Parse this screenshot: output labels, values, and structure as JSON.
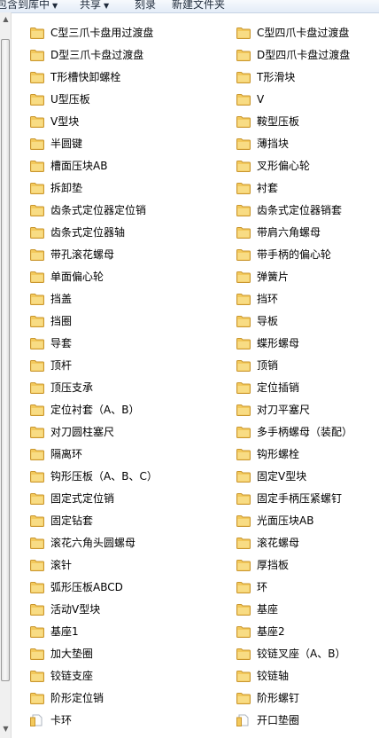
{
  "toolbar": {
    "items": [
      {
        "label": "包含到库中",
        "dropdown": true
      },
      {
        "label": "共享",
        "dropdown": true
      },
      {
        "label": "刻录",
        "dropdown": false
      },
      {
        "label": "新建文件夹",
        "dropdown": false
      }
    ]
  },
  "folder_color": "#f3c95c",
  "files": {
    "left": [
      {
        "name": "C型三爪卡盘用过渡盘",
        "icon": "folder-icon"
      },
      {
        "name": "D型三爪卡盘过渡盘",
        "icon": "folder-icon"
      },
      {
        "name": "T形槽快卸螺栓",
        "icon": "folder-icon"
      },
      {
        "name": "U型压板",
        "icon": "folder-icon"
      },
      {
        "name": "V型块",
        "icon": "folder-icon"
      },
      {
        "name": "半圆键",
        "icon": "folder-icon"
      },
      {
        "name": "槽面压块AB",
        "icon": "folder-icon"
      },
      {
        "name": "拆卸垫",
        "icon": "folder-icon"
      },
      {
        "name": "齿条式定位器定位销",
        "icon": "folder-icon"
      },
      {
        "name": "齿条式定位器轴",
        "icon": "folder-icon"
      },
      {
        "name": "带孔滚花螺母",
        "icon": "folder-icon"
      },
      {
        "name": "单面偏心轮",
        "icon": "folder-icon"
      },
      {
        "name": "挡盖",
        "icon": "folder-icon"
      },
      {
        "name": "挡圈",
        "icon": "folder-icon"
      },
      {
        "name": "导套",
        "icon": "folder-icon"
      },
      {
        "name": "顶杆",
        "icon": "folder-icon"
      },
      {
        "name": "顶压支承",
        "icon": "folder-icon"
      },
      {
        "name": "定位衬套（A、B）",
        "icon": "folder-icon"
      },
      {
        "name": "对刀圆柱塞尺",
        "icon": "folder-icon"
      },
      {
        "name": "隔离环",
        "icon": "folder-icon"
      },
      {
        "name": "钩形压板（A、B、C）",
        "icon": "folder-icon"
      },
      {
        "name": "固定式定位销",
        "icon": "folder-icon"
      },
      {
        "name": "固定钻套",
        "icon": "folder-icon"
      },
      {
        "name": "滚花六角头圆螺母",
        "icon": "folder-icon"
      },
      {
        "name": "滚针",
        "icon": "folder-icon"
      },
      {
        "name": "弧形压板ABCD",
        "icon": "folder-icon"
      },
      {
        "name": "活动V型块",
        "icon": "folder-icon"
      },
      {
        "name": "基座1",
        "icon": "folder-icon"
      },
      {
        "name": "加大垫圈",
        "icon": "folder-icon"
      },
      {
        "name": "铰链支座",
        "icon": "folder-icon"
      },
      {
        "name": "阶形定位销",
        "icon": "folder-icon"
      },
      {
        "name": "卡环",
        "icon": "folder-open-icon"
      }
    ],
    "right": [
      {
        "name": "C型四爪卡盘过渡盘",
        "icon": "folder-icon"
      },
      {
        "name": "D型四爪卡盘过渡盘",
        "icon": "folder-icon"
      },
      {
        "name": "T形滑块",
        "icon": "folder-icon"
      },
      {
        "name": "V",
        "icon": "folder-icon"
      },
      {
        "name": "鞍型压板",
        "icon": "folder-icon"
      },
      {
        "name": "薄挡块",
        "icon": "folder-icon"
      },
      {
        "name": "叉形偏心轮",
        "icon": "folder-icon"
      },
      {
        "name": "衬套",
        "icon": "folder-icon"
      },
      {
        "name": "齿条式定位器销套",
        "icon": "folder-icon"
      },
      {
        "name": "带肩六角螺母",
        "icon": "folder-icon"
      },
      {
        "name": "带手柄的偏心轮",
        "icon": "folder-icon"
      },
      {
        "name": "弹簧片",
        "icon": "folder-icon"
      },
      {
        "name": "挡环",
        "icon": "folder-icon"
      },
      {
        "name": "导板",
        "icon": "folder-icon"
      },
      {
        "name": "蝶形螺母",
        "icon": "folder-icon"
      },
      {
        "name": "顶销",
        "icon": "folder-icon"
      },
      {
        "name": "定位插销",
        "icon": "folder-icon"
      },
      {
        "name": "对刀平塞尺",
        "icon": "folder-icon"
      },
      {
        "name": "多手柄螺母（装配）",
        "icon": "folder-icon"
      },
      {
        "name": "钩形螺栓",
        "icon": "folder-icon"
      },
      {
        "name": "固定V型块",
        "icon": "folder-icon"
      },
      {
        "name": "固定手柄压紧螺钉",
        "icon": "folder-icon"
      },
      {
        "name": "光面压块AB",
        "icon": "folder-icon"
      },
      {
        "name": "滚花螺母",
        "icon": "folder-icon"
      },
      {
        "name": "厚挡板",
        "icon": "folder-icon"
      },
      {
        "name": "环",
        "icon": "folder-icon"
      },
      {
        "name": "基座",
        "icon": "folder-icon"
      },
      {
        "name": "基座2",
        "icon": "folder-icon"
      },
      {
        "name": "铰链叉座（A、B）",
        "icon": "folder-icon"
      },
      {
        "name": "铰链轴",
        "icon": "folder-icon"
      },
      {
        "name": "阶形螺钉",
        "icon": "folder-icon"
      },
      {
        "name": "开口垫圈",
        "icon": "folder-open-icon"
      }
    ]
  }
}
